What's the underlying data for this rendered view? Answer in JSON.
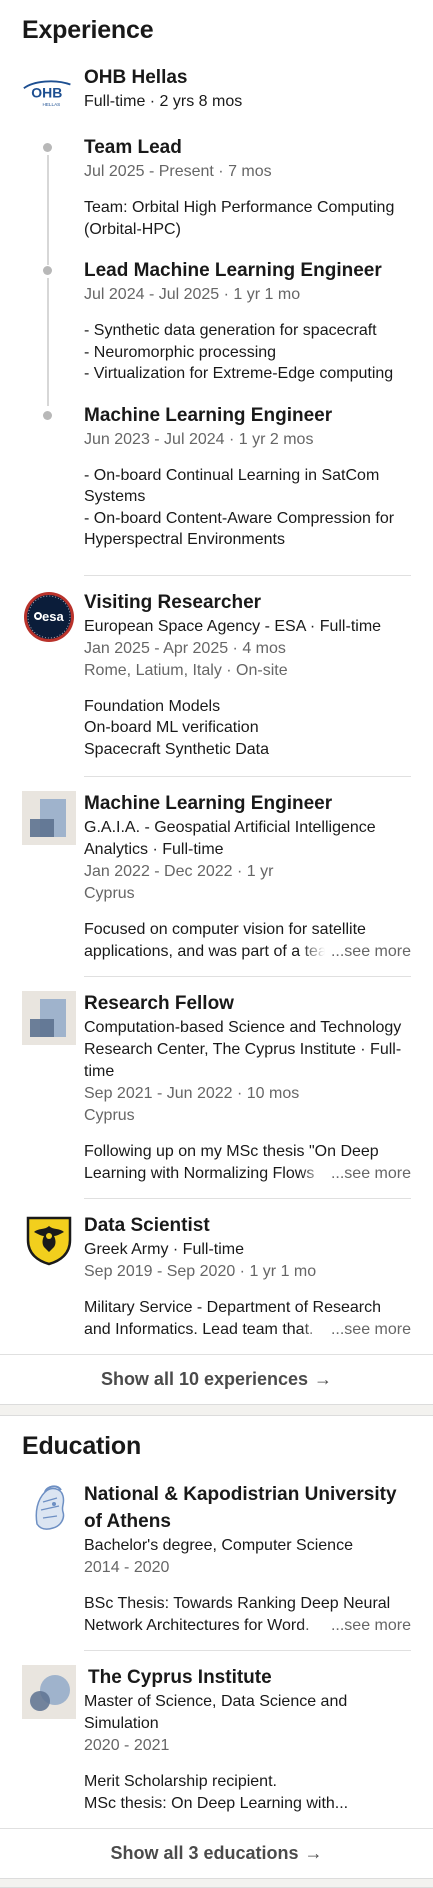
{
  "experience": {
    "title": "Experience",
    "ohb": {
      "company": "OHB Hellas",
      "meta": "Full-time · 2 yrs 8 mos",
      "logo_text": "OHB",
      "logo_sub": "HELLAS",
      "roles": [
        {
          "title": "Team Lead",
          "dates": "Jul 2025 - Present · 7 mos",
          "desc": "Team: Orbital High Performance Computing (Orbital-HPC)"
        },
        {
          "title": "Lead Machine Learning Engineer",
          "dates": "Jul 2024 - Jul 2025 · 1 yr 1 mo",
          "desc": "- Synthetic data generation for spacecraft\n- Neuromorphic processing\n- Virtualization for Extreme-Edge computing"
        },
        {
          "title": "Machine Learning Engineer",
          "dates": "Jun 2023 - Jul 2024 · 1 yr 2 mos",
          "desc": "- On-board Continual Learning in SatCom Systems\n- On-board Content-Aware Compression for Hyperspectral Environments"
        }
      ]
    },
    "esa": {
      "title": "Visiting Researcher",
      "org": "European Space Agency - ESA · Full-time",
      "dates": "Jan 2025 - Apr 2025 · 4 mos",
      "location": "Rome, Latium, Italy · On-site",
      "desc": "Foundation Models\nOn-board ML verification\nSpacecraft Synthetic Data",
      "logo_text": "esa"
    },
    "gaia": {
      "title": "Machine Learning Engineer",
      "org": "G.A.I.A. - Geospatial Artificial Intelligence Analytics · Full-time",
      "dates": "Jan 2022 - Dec 2022 · 1 yr",
      "location": "Cyprus",
      "desc": "Focused on computer vision for satellite applications, and was part of a team",
      "see_more": "...see more"
    },
    "cyi": {
      "title": "Research Fellow",
      "org": "Computation-based Science and Technology Research Center, The Cyprus Institute · Full-time",
      "dates": "Sep 2021 - Jun 2022 · 10 mos",
      "location": "Cyprus",
      "desc": "Following up on my MSc thesis \"On Deep Learning with Normalizing Flows",
      "see_more": "...see more"
    },
    "army": {
      "title": "Data Scientist",
      "org": "Greek Army · Full-time",
      "dates": "Sep 2019 - Sep 2020 · 1 yr 1 mo",
      "desc": "Military Service - Department of Research and Informatics. Lead team that.",
      "see_more": "...see more"
    },
    "show_all": "Show all 10 experiences",
    "arrow": "→"
  },
  "education": {
    "title": "Education",
    "items": [
      {
        "school": "National & Kapodistrian University of Athens",
        "degree": "Bachelor's degree, Computer Science",
        "dates": "2014 - 2020",
        "desc": "BSc Thesis: Towards Ranking Deep Neural Network Architectures for Word.",
        "see_more": "...see more"
      },
      {
        "school": "The Cyprus Institute",
        "degree": "Master of Science, Data Science and Simulation",
        "dates": "2020 - 2021",
        "desc": "Merit Scholarship recipient.\nMSc thesis: On Deep Learning with..."
      }
    ],
    "show_all": "Show all 3 educations",
    "arrow": "→"
  },
  "colors": {
    "primary_text": "#191919",
    "secondary_text": "#666666",
    "divider": "#e0e0e0",
    "esa_navy": "#0b1d3a",
    "army_yellow": "#f2cf1d",
    "ohb_blue": "#1d4f91"
  }
}
